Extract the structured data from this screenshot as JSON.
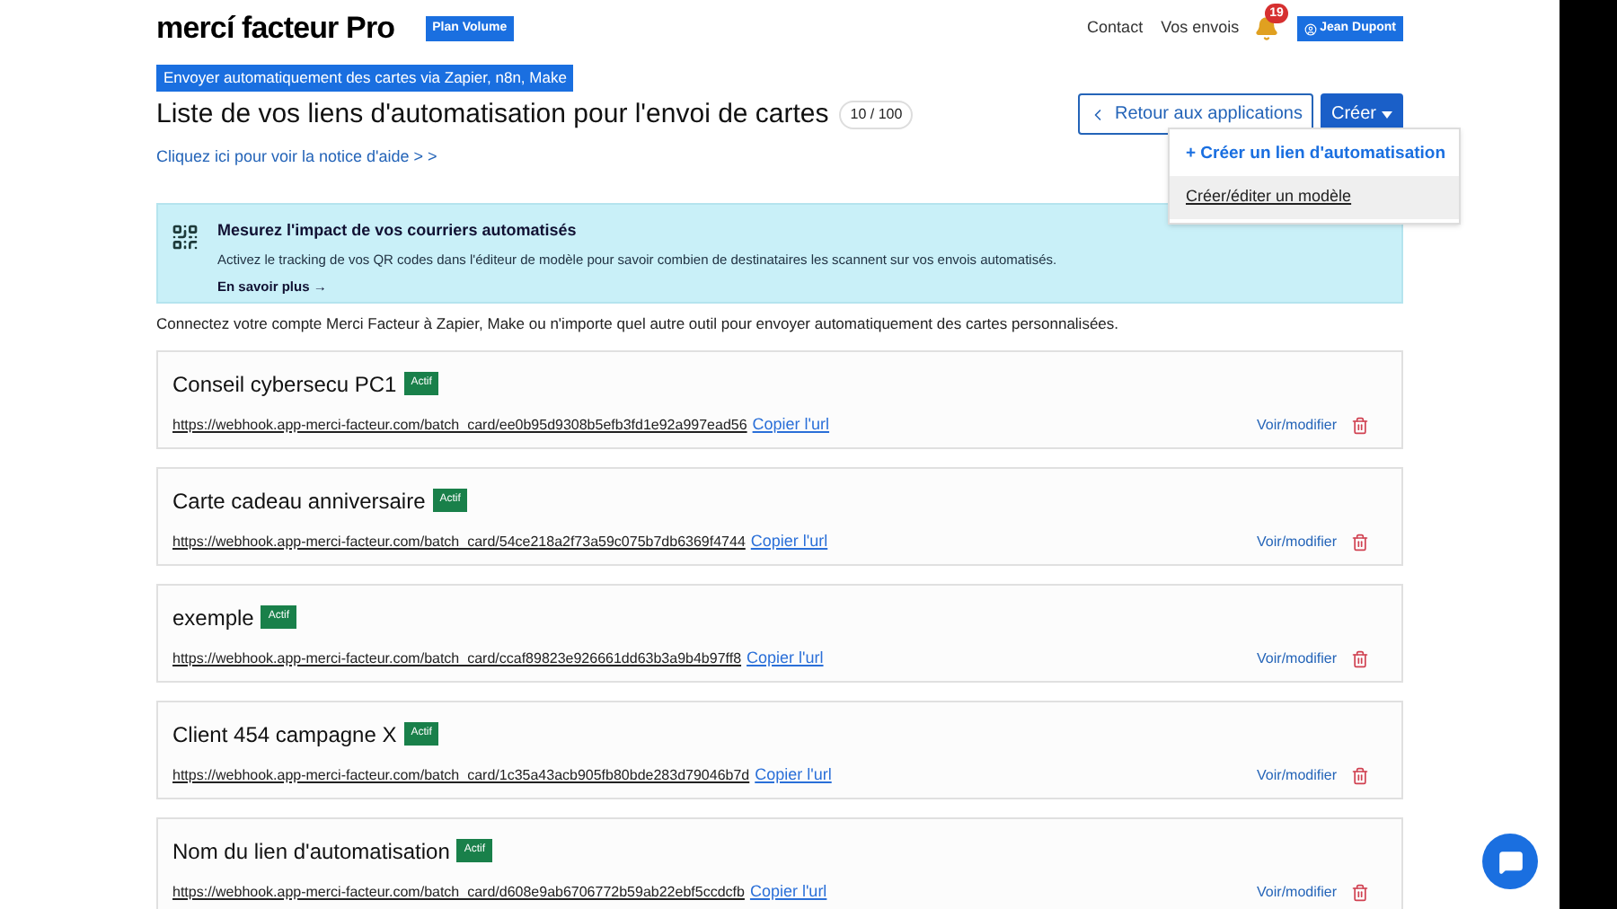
{
  "header": {
    "logo": "mercí facteur Pro",
    "plan_badge": "Plan Volume",
    "nav": [
      "Contact",
      "Vos envois"
    ],
    "notification_count": "19",
    "user": "Jean Dupont"
  },
  "page": {
    "breadcrumb": "Envoyer automatiquement des cartes via Zapier, n8n, Make",
    "title": "Liste de vos liens d'automatisation pour l'envoi de cartes",
    "count": "10 / 100",
    "help_link": "Cliquez ici pour voir la notice d'aide > >",
    "back_button": "Retour aux applications",
    "create_button": "Créer"
  },
  "create_menu": {
    "items": [
      {
        "label": "+ Créer un lien d'automatisation",
        "kind": "primary",
        "selected": false
      },
      {
        "label": "Créer/éditer un modèle",
        "kind": "plain",
        "selected": true
      }
    ]
  },
  "banner": {
    "title": "Mesurez l'impact de vos courriers automatisés",
    "text": "Activez le tracking de vos QR codes dans l'éditeur de modèle pour savoir combien de destinataires les scannent sur vos envois automatisés.",
    "link": "En savoir plus →"
  },
  "intro": "Connectez votre compte Merci Facteur à Zapier, Make ou n'importe quel autre outil pour envoyer automatiquement des cartes personnalisées.",
  "links": [
    {
      "name": "Conseil cybersecu PC1",
      "status": "Actif",
      "active": true,
      "url": "https://webhook.app-merci-facteur.com/batch_card/ee0b95d9308b5efb3fd1e92a997ead56",
      "copy": "Copier l'url",
      "edit": "Voir/modifier"
    },
    {
      "name": "Carte cadeau anniversaire",
      "status": "Actif",
      "active": true,
      "url": "https://webhook.app-merci-facteur.com/batch_card/54ce218a2f73a59c075b7db6369f4744",
      "copy": "Copier l'url",
      "edit": "Voir/modifier"
    },
    {
      "name": "exemple",
      "status": "Actif",
      "active": true,
      "url": "https://webhook.app-merci-facteur.com/batch_card/ccaf89823e926661dd63b3a9b4b97ff8",
      "copy": "Copier l'url",
      "edit": "Voir/modifier"
    },
    {
      "name": "Client 454 campagne X",
      "status": "Actif",
      "active": true,
      "url": "https://webhook.app-merci-facteur.com/batch_card/1c35a43acb905fb80bde283d79046b7d",
      "copy": "Copier l'url",
      "edit": "Voir/modifier"
    },
    {
      "name": "Nom du lien d'automatisation",
      "status": "Actif",
      "active": true,
      "url": "https://webhook.app-merci-facteur.com/batch_card/d608e9ab6706772b59ab22ebf5ccdcfb",
      "copy": "Copier l'url",
      "edit": "Voir/modifier"
    }
  ]
}
